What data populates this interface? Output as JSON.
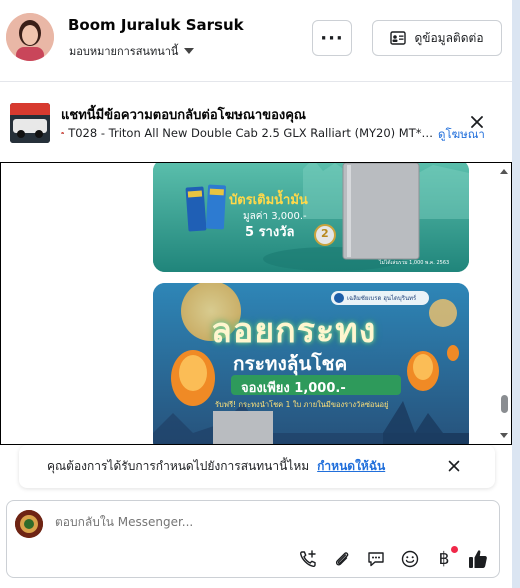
{
  "header": {
    "name": "Boom Juraluk Sarsuk",
    "assign_label": "มอบหมายการสนทนานี้",
    "more_label": "···",
    "contact_label": "ดูข้อมูลติดต่อ"
  },
  "ad_banner": {
    "title": "แชทนี้มีข้อความตอบกลับต่อโฆษณาของคุณ",
    "subtitle": "T028 - Triton All New Double Cab 2.5 GLX Ralliart (MY20) MT*…",
    "view_ad_link": "ดูโฆษณา"
  },
  "media": {
    "image1": {
      "headline": "บัตรเติมน้ำมัน",
      "value_line": "มูลค่า 3,000.-",
      "prize_count": "5 รางวัล",
      "badge_number": "2",
      "fine_print": "ไม่ได้เล่นรวม 1,000 พ.ค. 2563"
    },
    "image2": {
      "brand": "เฉลิมชัยเบรด ฮุนไดบุรินทร์",
      "title": "ลอยกระทง",
      "subtitle": "กระทงลุ้นโชค",
      "price_line": "จองเพียง 1,000.-",
      "condition": "รับฟรี! กระทงนำโชค 1 ใบ ภายในมีของรางวัลซ่อนอยู่"
    }
  },
  "notice": {
    "text": "คุณต้องการได้รับการกำหนดไปยังการสนทนานี้ไหม",
    "link": "กำหนดให้ฉัน"
  },
  "composer": {
    "placeholder": "ตอบกลับใน Messenger...",
    "baht_symbol": "฿"
  },
  "colors": {
    "link": "#216fdb",
    "notification_dot": "#f02849",
    "like": "#1c1e21"
  }
}
